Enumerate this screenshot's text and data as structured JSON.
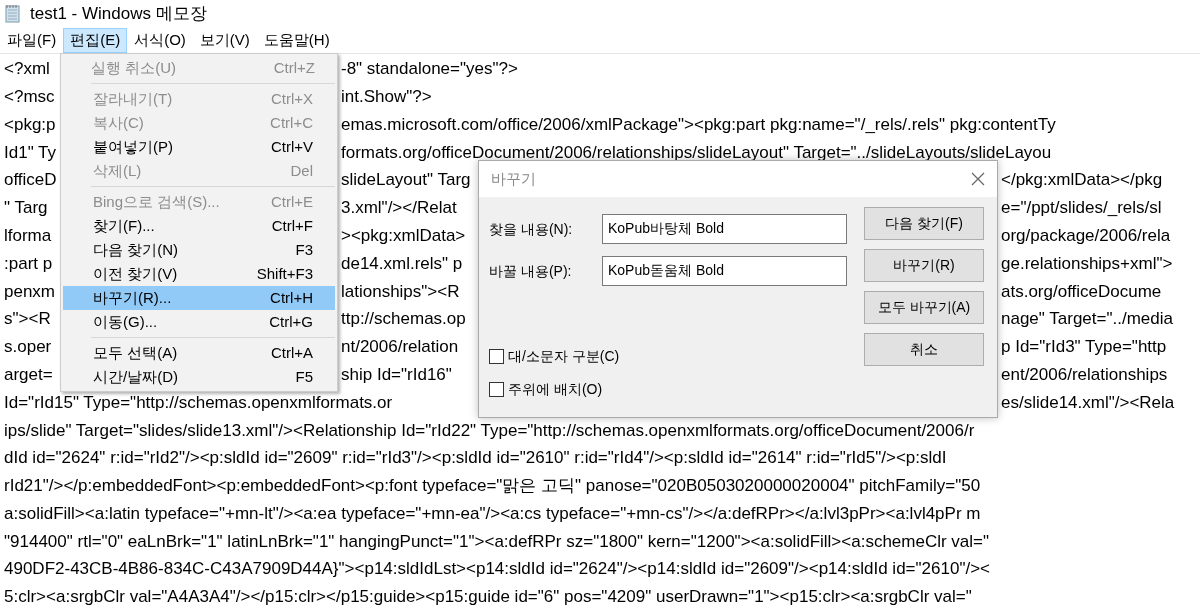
{
  "window": {
    "title": "test1 - Windows 메모장"
  },
  "menu_bar": [
    {
      "label": "파일(F)",
      "selected": false
    },
    {
      "label": "편집(E)",
      "selected": true
    },
    {
      "label": "서식(O)",
      "selected": false
    },
    {
      "label": "보기(V)",
      "selected": false
    },
    {
      "label": "도움말(H)",
      "selected": false
    }
  ],
  "editor": {
    "lines": [
      {
        "kind": "menu",
        "segments": [
          "<?xml",
          "-8\" standalone=\"yes\"?>"
        ]
      },
      {
        "kind": "menu",
        "segments": [
          "<?msc",
          "int.Show\"?>"
        ]
      },
      {
        "kind": "menu",
        "segments": [
          "<pkg:p",
          "emas.microsoft.com/office/2006/xmlPackage\"><pkg:part pkg:name=\"/_rels/.rels\" pkg:contentTy"
        ]
      },
      {
        "kind": "menu",
        "segments": [
          "Id1\" Ty",
          "formats.org/officeDocument/2006/relationships/slideLayout\" Target=\"../slideLayouts/slideLayou"
        ]
      },
      {
        "kind": "both",
        "segments": [
          "officeD",
          "slideLayout\" Targ",
          "</pkg:xmlData></pkg"
        ]
      },
      {
        "kind": "both",
        "segments": [
          "\" Targ",
          "3.xml\"/></Relat",
          "e=\"/ppt/slides/_rels/sl"
        ]
      },
      {
        "kind": "both",
        "segments": [
          "lforma",
          "><pkg:xmlData>",
          "org/package/2006/rela"
        ]
      },
      {
        "kind": "both",
        "segments": [
          ":part p",
          "de14.xml.rels\" p",
          "ge.relationships+xml\">"
        ]
      },
      {
        "kind": "both",
        "segments": [
          "penxm",
          "lationships\"><R",
          "ats.org/officeDocume"
        ]
      },
      {
        "kind": "both",
        "segments": [
          "s\"><R",
          "ttp://schemas.op",
          "nage\" Target=\"../media"
        ]
      },
      {
        "kind": "both",
        "segments": [
          "s.oper",
          "nt/2006/relation",
          "p Id=\"rId3\" Type=\"http"
        ]
      },
      {
        "kind": "both",
        "segments": [
          "arget=",
          "ship Id=\"rId16\"",
          "ent/2006/relationships"
        ]
      },
      {
        "kind": "dialog",
        "segments": [
          "Id=\"rId15\" Type=\"http://schemas.openxmlformats.or",
          "es/slide14.xml\"/><Rela"
        ]
      },
      {
        "kind": "full",
        "segments": [
          "ips/slide\" Target=\"slides/slide13.xml\"/><Relationship Id=\"rId22\" Type=\"http://schemas.openxmlformats.org/officeDocument/2006/r"
        ]
      },
      {
        "kind": "full",
        "segments": [
          "dId id=\"2624\" r:id=\"rId2\"/><p:sldId id=\"2609\" r:id=\"rId3\"/><p:sldId id=\"2610\" r:id=\"rId4\"/><p:sldId id=\"2614\" r:id=\"rId5\"/><p:sldI"
        ]
      },
      {
        "kind": "full",
        "segments": [
          "rId21\"/></p:embeddedFont><p:embeddedFont><p:font typeface=\"맑은 고딕\" panose=\"020B0503020000020004\" pitchFamily=\"50"
        ]
      },
      {
        "kind": "full",
        "segments": [
          "a:solidFill><a:latin typeface=\"+mn-lt\"/><a:ea typeface=\"+mn-ea\"/><a:cs typeface=\"+mn-cs\"/></a:defRPr></a:lvl3pPr><a:lvl4pPr m"
        ]
      },
      {
        "kind": "full",
        "segments": [
          "\"914400\" rtl=\"0\" eaLnBrk=\"1\" latinLnBrk=\"1\" hangingPunct=\"1\"><a:defRPr sz=\"1800\" kern=\"1200\"><a:solidFill><a:schemeClr val=\""
        ]
      },
      {
        "kind": "full",
        "segments": [
          "490DF2-43CB-4B86-834C-C43A7909D44A}\"><p14:sldIdLst><p14:sldId id=\"2624\"/><p14:sldId id=\"2609\"/><p14:sldId id=\"2610\"/><"
        ]
      },
      {
        "kind": "full",
        "segments": [
          "5:clr><a:srgbClr val=\"A4A3A4\"/></p15:clr></p15:guide><p15:guide id=\"6\" pos=\"4209\" userDrawn=\"1\"><p15:clr><a:srgbClr val=\""
        ]
      }
    ]
  },
  "edit_menu": {
    "groups": [
      [
        {
          "label": "실행 취소(U)",
          "shortcut": "Ctrl+Z",
          "disabled": true,
          "selected": false
        }
      ],
      [
        {
          "label": "잘라내기(T)",
          "shortcut": "Ctrl+X",
          "disabled": true,
          "selected": false
        },
        {
          "label": "복사(C)",
          "shortcut": "Ctrl+C",
          "disabled": true,
          "selected": false
        },
        {
          "label": "붙여넣기(P)",
          "shortcut": "Ctrl+V",
          "disabled": false,
          "selected": false
        },
        {
          "label": "삭제(L)",
          "shortcut": "Del",
          "disabled": true,
          "selected": false
        }
      ],
      [
        {
          "label": "Bing으로 검색(S)...",
          "shortcut": "Ctrl+E",
          "disabled": true,
          "selected": false
        },
        {
          "label": "찾기(F)...",
          "shortcut": "Ctrl+F",
          "disabled": false,
          "selected": false
        },
        {
          "label": "다음 찾기(N)",
          "shortcut": "F3",
          "disabled": false,
          "selected": false
        },
        {
          "label": "이전 찾기(V)",
          "shortcut": "Shift+F3",
          "disabled": false,
          "selected": false
        },
        {
          "label": "바꾸기(R)...",
          "shortcut": "Ctrl+H",
          "disabled": false,
          "selected": true
        },
        {
          "label": "이동(G)...",
          "shortcut": "Ctrl+G",
          "disabled": false,
          "selected": false
        }
      ],
      [
        {
          "label": "모두 선택(A)",
          "shortcut": "Ctrl+A",
          "disabled": false,
          "selected": false
        },
        {
          "label": "시간/날짜(D)",
          "shortcut": "F5",
          "disabled": false,
          "selected": false
        }
      ]
    ]
  },
  "replace_dialog": {
    "title": "바꾸기",
    "fields": [
      {
        "label": "찾을 내용(N):",
        "value": "KoPub바탕체 Bold"
      },
      {
        "label": "바꿀 내용(P):",
        "value": "KoPub돋움체 Bold"
      }
    ],
    "buttons": [
      "다음 찾기(F)",
      "바꾸기(R)",
      "모두 바꾸기(A)",
      "취소"
    ],
    "options": [
      {
        "label": "대/소문자 구분(C)",
        "checked": false
      },
      {
        "label": "주위에 배치(O)",
        "checked": false
      }
    ]
  }
}
